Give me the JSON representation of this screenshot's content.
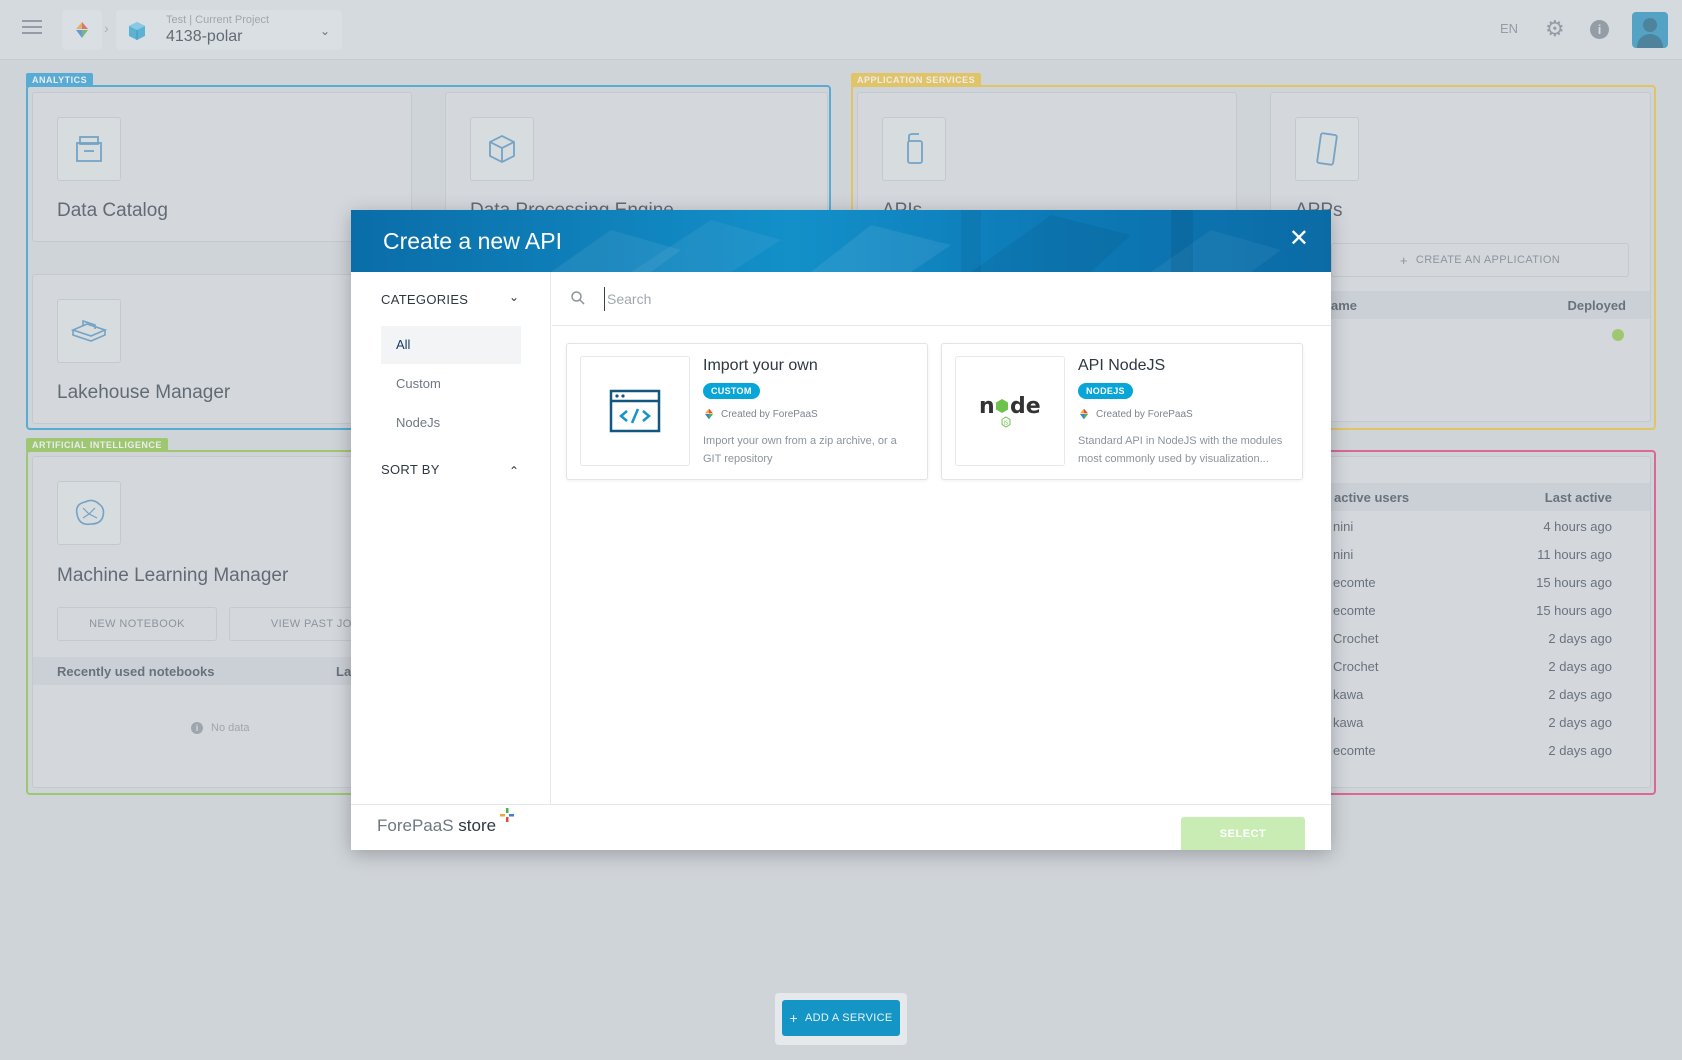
{
  "topbar": {
    "project_sub": "Test | Current Project",
    "project_name": "4138-polar",
    "lang": "EN"
  },
  "sections": {
    "analytics": "ANALYTICS",
    "app_services": "APPLICATION SERVICES",
    "ai": "ARTIFICIAL INTELLIGENCE"
  },
  "cards": {
    "data_catalog": "Data Catalog",
    "data_processing": "Data Processing Engine",
    "apis": "APIs",
    "apps": "APPs",
    "lakehouse": "Lakehouse Manager",
    "ml": "Machine Learning Manager"
  },
  "apps_panel": {
    "create_label": "CREATE AN APPLICATION",
    "col_name": "ame",
    "col_deployed": "Deployed"
  },
  "ml_panel": {
    "new_notebook": "NEW NOTEBOOK",
    "view_past_jobs": "VIEW PAST JOBS",
    "recent_header": "Recently used notebooks",
    "recent_header_right": "La",
    "no_data": "No data"
  },
  "users_panel": {
    "col_users": "active users",
    "col_last": "Last active",
    "rows": [
      {
        "name": "nini",
        "last": "4 hours ago"
      },
      {
        "name": "nini",
        "last": "11 hours ago"
      },
      {
        "name": "ecomte",
        "last": "15 hours ago"
      },
      {
        "name": "ecomte",
        "last": "15 hours ago"
      },
      {
        "name": "Crochet",
        "last": "2 days ago"
      },
      {
        "name": "Crochet",
        "last": "2 days ago"
      },
      {
        "name": "kawa",
        "last": "2 days ago"
      },
      {
        "name": "kawa",
        "last": "2 days ago"
      },
      {
        "name": "ecomte",
        "last": "2 days ago"
      }
    ]
  },
  "modal": {
    "title": "Create a new API",
    "categories_label": "CATEGORIES",
    "categories": [
      "All",
      "Custom",
      "NodeJs"
    ],
    "sort_label": "SORT BY",
    "search_placeholder": "Search",
    "items": [
      {
        "title": "Import your own",
        "badge": "CUSTOM",
        "creator": "Created by ForePaaS",
        "desc": "Import your own from a zip archive, or a GIT repository"
      },
      {
        "title": "API NodeJS",
        "badge": "NODEJS",
        "creator": "Created by ForePaaS",
        "desc": "Standard API in NodeJS with the modules most commonly used by visualization..."
      }
    ],
    "brand_a": "ForePaaS",
    "brand_b": "store",
    "select_label": "SELECT"
  },
  "add_service": "ADD A SERVICE",
  "colors": {
    "analytics": "#1f9bd7",
    "app_services": "#f1c232",
    "ai": "#8cc63f",
    "users": "#e8347c",
    "accent": "#1595c6"
  }
}
